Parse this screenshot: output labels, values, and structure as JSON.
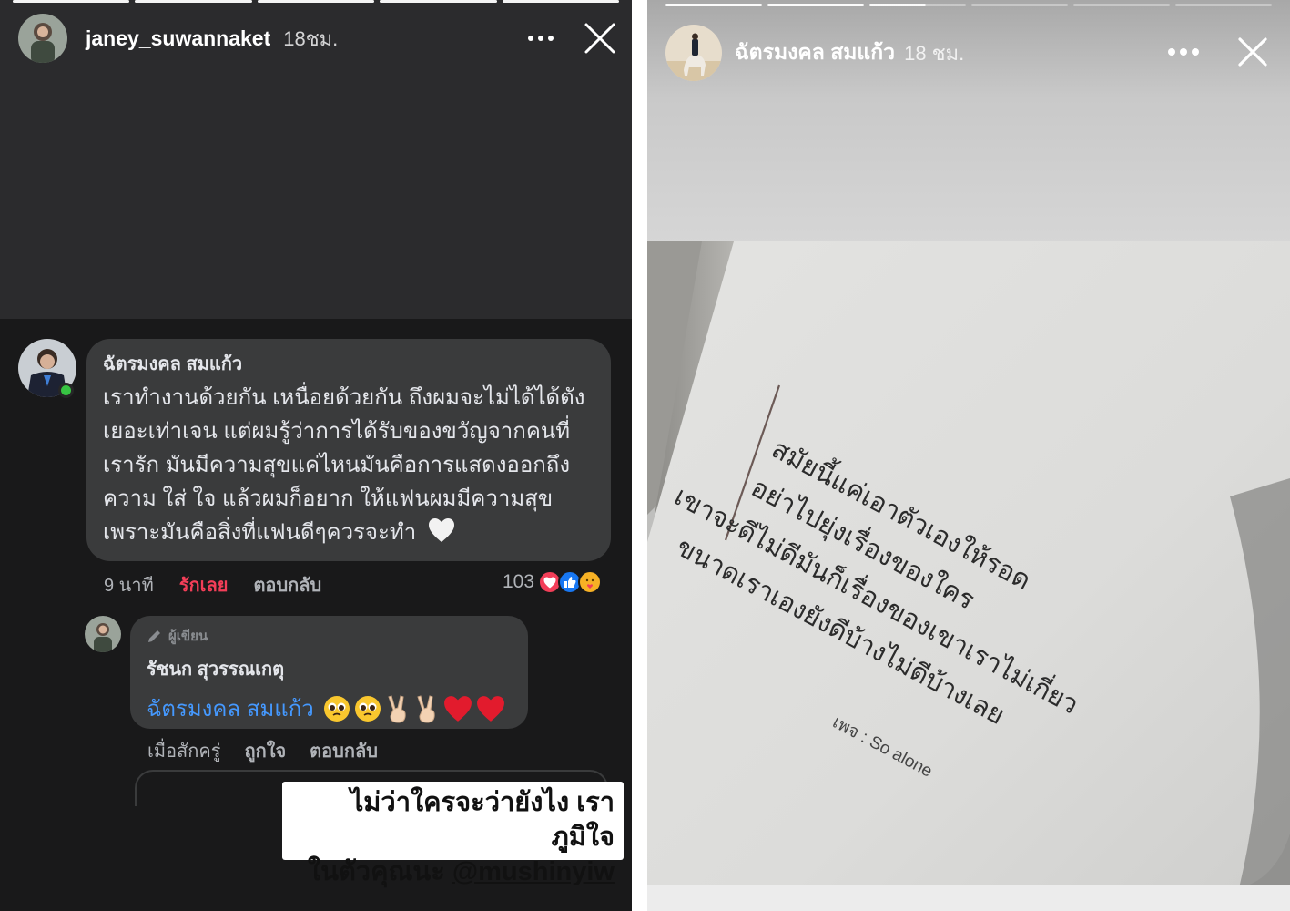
{
  "left_story": {
    "header": {
      "username": "janey_suwannaket",
      "time": "18ชม.",
      "more_icon": "more-dots-icon",
      "close_icon": "close-icon"
    },
    "comment": {
      "author": "ฉัตรมงคล สมแก้ว",
      "lines": [
        "เราทำงานด้วยกัน เหนื่อยด้วยกัน ถึงผมจะไม่ได้ได้ตัง",
        "เยอะเท่าเจน แต่ผมรู้ว่าการได้รับของขวัญจากคนที่",
        "เรารัก มันมีความสุขแค่ไหนมันคือการแสดงออกถึง",
        "ความ ใส่ ใจ แล้วผมก็อยาก ให้แฟนผมมีความสุข",
        "เพราะมันคือสิ่งที่แฟนดีๆควรจะทำ"
      ],
      "time": "9 นาที",
      "love_label": "รักเลย",
      "reply_label": "ตอบกลับ",
      "reaction_count": "103",
      "reaction_icons": [
        "heart-react-icon",
        "like-react-icon",
        "care-react-icon"
      ]
    },
    "reply": {
      "badge": "ผู้เขียน",
      "author": "รัชนก สุวรรณเกตุ",
      "mention": "ฉัตรมงคล สมแก้ว",
      "emojis": [
        "pleading-face-icon",
        "pleading-face-icon",
        "victory-hand-icon",
        "victory-hand-icon",
        "red-heart-icon",
        "red-heart-icon"
      ],
      "time": "เมื่อสักครู่",
      "like_label": "ถูกใจ",
      "reply_label": "ตอบกลับ"
    },
    "caption": {
      "line1": "ไม่ว่าใครจะว่ายังไง เราภูมิใจ",
      "line2_prefix": "ในตัวคุณนะ ",
      "mention": "@mushinyiw"
    }
  },
  "right_story": {
    "header": {
      "username": "ฉัตรมงคล สมแก้ว",
      "time": "18 ชม.",
      "more_icon": "more-dots-icon",
      "close_icon": "close-icon"
    },
    "book_lines": [
      "สมัยนี้แค่เอาตัวเองให้รอด",
      "อย่าไปยุ่งเรื่องของใคร",
      "เขาจะดีไม่ดีมันก็เรื่องของเขาเราไม่เกี่ยว",
      "ขนาดเราเองยังดีบ้างไม่ดีบ้างเลย"
    ],
    "song_credit": "เพจ : So alone"
  },
  "colors": {
    "love_red": "#f33e58",
    "mention_blue": "#4599ff",
    "online_green": "#37c443",
    "bubble_bg": "#3a3b3c"
  }
}
